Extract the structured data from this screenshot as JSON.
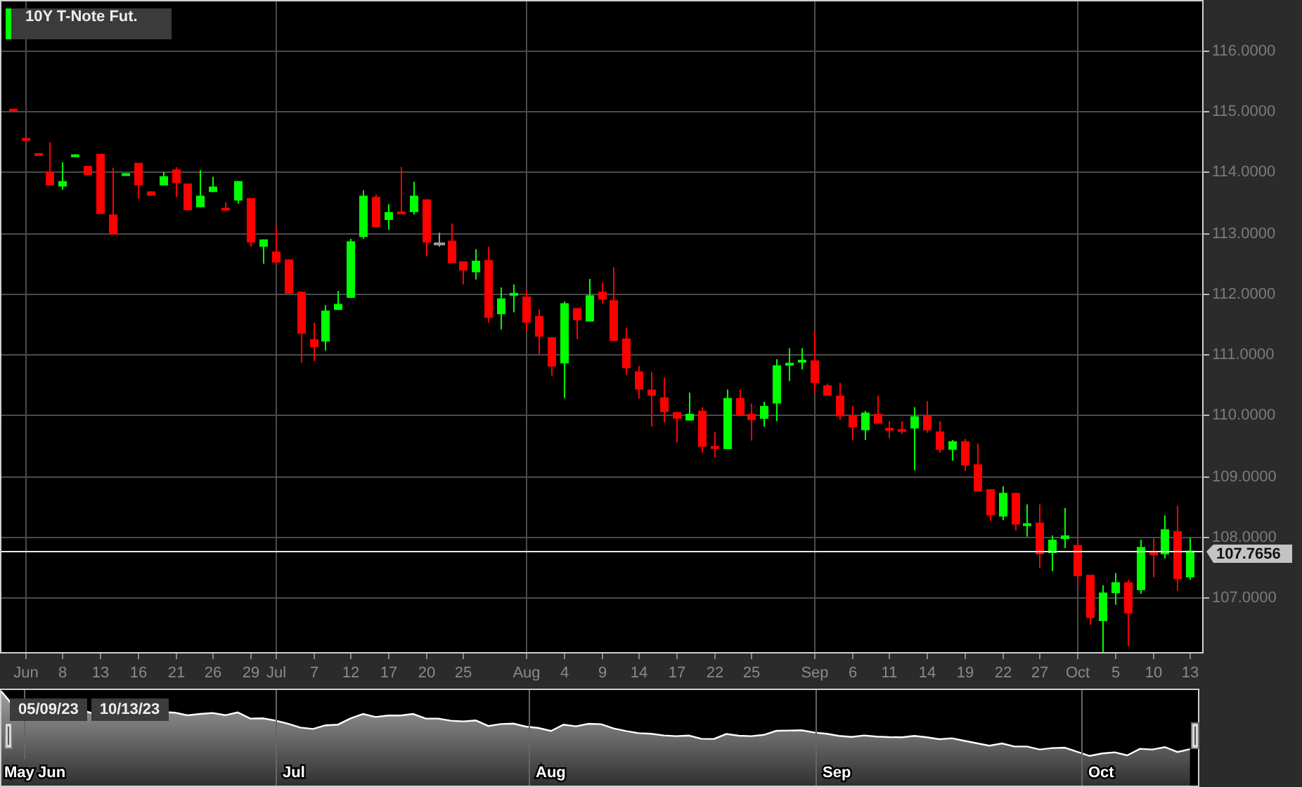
{
  "chart": {
    "chart_data": {
      "type": "candlestick",
      "title": "10Y T-Note Fut.",
      "categories": [
        null,
        "Jun",
        null,
        null,
        "8",
        null,
        null,
        "13",
        null,
        null,
        "16",
        null,
        null,
        "21",
        null,
        null,
        "26",
        null,
        null,
        "29",
        null,
        "Jul",
        null,
        null,
        "7",
        null,
        null,
        "12",
        null,
        null,
        "17",
        null,
        null,
        "20",
        null,
        null,
        "25",
        null,
        null,
        null,
        null,
        "Aug",
        null,
        null,
        "4",
        null,
        null,
        "9",
        null,
        null,
        "14",
        null,
        null,
        "17",
        null,
        null,
        "22",
        null,
        null,
        "25",
        null,
        null,
        null,
        null,
        "Sep",
        null,
        null,
        "6",
        null,
        null,
        "11",
        null,
        null,
        "14",
        null,
        null,
        "19",
        null,
        null,
        "22",
        null,
        null,
        "27",
        null,
        null,
        "Oct",
        null,
        null,
        "5",
        null,
        null,
        "10",
        null,
        null,
        "13"
      ],
      "ylim": [
        106.1,
        116.83
      ],
      "yticks": [
        {
          "value": 107,
          "label": "107.0000"
        },
        {
          "value": 108,
          "label": "108.0000"
        },
        {
          "value": 109,
          "label": "109.0000"
        },
        {
          "value": 110,
          "label": "110.0000"
        },
        {
          "value": 111,
          "label": "111.0000"
        },
        {
          "value": 112,
          "label": "112.0000"
        },
        {
          "value": 113,
          "label": "113.0000"
        },
        {
          "value": 114,
          "label": "114.0000"
        },
        {
          "value": 115,
          "label": "115.0000"
        },
        {
          "value": 116,
          "label": "116.0000"
        }
      ],
      "ohlc": [
        [
          115.04,
          115.04,
          115.03,
          115.03
        ],
        [
          114.56,
          114.56,
          114.55,
          114.55
        ],
        [
          114.31,
          114.31,
          114.3,
          114.3
        ],
        [
          114.0,
          114.49,
          113.78,
          113.78
        ],
        [
          113.76,
          114.16,
          113.71,
          113.85
        ],
        [
          114.28,
          114.29,
          114.28,
          114.29
        ],
        [
          114.1,
          114.1,
          113.95,
          113.95
        ],
        [
          114.3,
          114.3,
          113.31,
          113.31
        ],
        [
          113.3,
          114.07,
          112.97,
          112.97
        ],
        [
          113.97,
          113.98,
          113.97,
          113.98
        ],
        [
          114.15,
          114.15,
          113.56,
          113.78
        ],
        [
          113.68,
          113.68,
          113.61,
          113.61
        ],
        [
          113.78,
          114.0,
          113.78,
          113.93
        ],
        [
          114.04,
          114.08,
          113.59,
          113.82
        ],
        [
          113.81,
          113.81,
          113.37,
          113.37
        ],
        [
          113.42,
          114.03,
          113.42,
          113.61
        ],
        [
          113.67,
          113.92,
          113.67,
          113.76
        ],
        [
          113.41,
          113.5,
          113.4,
          113.4
        ],
        [
          113.53,
          113.85,
          113.48,
          113.85
        ],
        [
          113.57,
          113.57,
          112.77,
          112.84
        ],
        [
          112.77,
          112.89,
          112.49,
          112.89
        ],
        [
          112.69,
          113.1,
          112.51,
          112.51
        ],
        [
          112.56,
          112.56,
          112.0,
          112.0
        ],
        [
          112.03,
          112.03,
          110.86,
          111.34
        ],
        [
          111.25,
          111.52,
          110.89,
          111.12
        ],
        [
          111.21,
          111.81,
          111.06,
          111.72
        ],
        [
          111.73,
          112.04,
          111.73,
          111.83
        ],
        [
          111.93,
          112.9,
          111.93,
          112.86
        ],
        [
          112.93,
          113.7,
          112.9,
          113.61
        ],
        [
          113.59,
          113.63,
          113.09,
          113.09
        ],
        [
          113.21,
          113.47,
          113.05,
          113.34
        ],
        [
          113.35,
          114.08,
          113.31,
          113.34
        ],
        [
          113.34,
          113.84,
          113.3,
          113.61
        ],
        [
          113.55,
          113.55,
          112.61,
          112.84
        ],
        [
          112.84,
          113.0,
          112.77,
          112.84
        ],
        [
          112.87,
          113.15,
          112.5,
          112.5
        ],
        [
          112.53,
          112.53,
          112.15,
          112.38
        ],
        [
          112.35,
          112.73,
          112.23,
          112.54
        ],
        [
          112.55,
          112.77,
          111.52,
          111.6
        ],
        [
          111.66,
          112.1,
          111.41,
          111.92
        ],
        [
          111.99,
          112.15,
          111.69,
          112.01
        ],
        [
          111.95,
          112.05,
          111.39,
          111.52
        ],
        [
          111.63,
          111.74,
          111.0,
          111.29
        ],
        [
          111.28,
          111.28,
          110.65,
          110.8
        ],
        [
          110.85,
          111.87,
          110.28,
          111.84
        ],
        [
          111.76,
          111.76,
          111.25,
          111.56
        ],
        [
          111.54,
          112.24,
          111.54,
          111.97
        ],
        [
          112.03,
          112.18,
          111.84,
          111.9
        ],
        [
          111.89,
          112.43,
          111.22,
          111.22
        ],
        [
          111.26,
          111.43,
          110.66,
          110.77
        ],
        [
          110.72,
          110.81,
          110.27,
          110.42
        ],
        [
          110.42,
          110.71,
          109.81,
          110.32
        ],
        [
          110.29,
          110.62,
          109.88,
          110.05
        ],
        [
          110.05,
          110.05,
          109.55,
          109.94
        ],
        [
          109.91,
          110.37,
          109.91,
          110.02
        ],
        [
          110.07,
          110.13,
          109.38,
          109.48
        ],
        [
          109.49,
          109.72,
          109.3,
          109.47
        ],
        [
          109.44,
          110.42,
          109.44,
          110.28
        ],
        [
          110.28,
          110.42,
          109.99,
          109.99
        ],
        [
          110.02,
          110.19,
          109.58,
          109.92
        ],
        [
          109.94,
          110.22,
          109.81,
          110.15
        ],
        [
          110.19,
          110.92,
          109.9,
          110.82
        ],
        [
          110.84,
          111.1,
          110.56,
          110.86
        ],
        [
          110.87,
          111.1,
          110.75,
          110.91
        ],
        [
          110.9,
          111.38,
          110.36,
          110.53
        ],
        [
          110.49,
          110.52,
          110.32,
          110.32
        ],
        [
          110.32,
          110.53,
          109.92,
          109.98
        ],
        [
          109.99,
          110.15,
          109.59,
          109.8
        ],
        [
          109.75,
          110.07,
          109.59,
          110.04
        ],
        [
          110.02,
          110.32,
          109.86,
          109.86
        ],
        [
          109.79,
          109.9,
          109.62,
          109.77
        ],
        [
          109.77,
          109.9,
          109.69,
          109.75
        ],
        [
          109.78,
          110.13,
          109.09,
          109.98
        ],
        [
          109.99,
          110.23,
          109.71,
          109.75
        ],
        [
          109.73,
          109.9,
          109.38,
          109.43
        ],
        [
          109.43,
          109.59,
          109.25,
          109.57
        ],
        [
          109.57,
          109.61,
          109.08,
          109.17
        ],
        [
          109.19,
          109.53,
          108.74,
          108.74
        ],
        [
          108.78,
          108.78,
          108.26,
          108.35
        ],
        [
          108.33,
          108.83,
          108.27,
          108.72
        ],
        [
          108.72,
          108.72,
          108.1,
          108.2
        ],
        [
          108.2,
          108.53,
          108.0,
          108.22
        ],
        [
          108.23,
          108.53,
          107.48,
          107.71
        ],
        [
          107.73,
          108.02,
          107.43,
          107.95
        ],
        [
          107.96,
          108.47,
          107.81,
          108.02
        ],
        [
          107.86,
          107.93,
          107.2,
          107.35
        ],
        [
          107.37,
          107.37,
          106.55,
          106.66
        ],
        [
          106.61,
          107.2,
          106.1,
          107.08
        ],
        [
          107.07,
          107.4,
          106.88,
          107.25
        ],
        [
          107.25,
          107.29,
          106.2,
          106.74
        ],
        [
          107.12,
          107.95,
          107.06,
          107.83
        ],
        [
          107.74,
          107.97,
          107.33,
          107.72
        ],
        [
          107.71,
          108.35,
          107.64,
          108.12
        ],
        [
          108.09,
          108.51,
          107.11,
          107.3
        ],
        [
          107.33,
          107.98,
          107.29,
          107.77
        ]
      ],
      "grid": true,
      "ref_lines": [
        {
          "axis": "y",
          "value": 107.7656,
          "label": "107.7656"
        }
      ]
    }
  },
  "navigator": {
    "range_start": "05/09/23",
    "range_end": "10/13/23",
    "months": [
      "May",
      "Jun",
      "Jul",
      "Aug",
      "Sep",
      "Oct"
    ]
  }
}
